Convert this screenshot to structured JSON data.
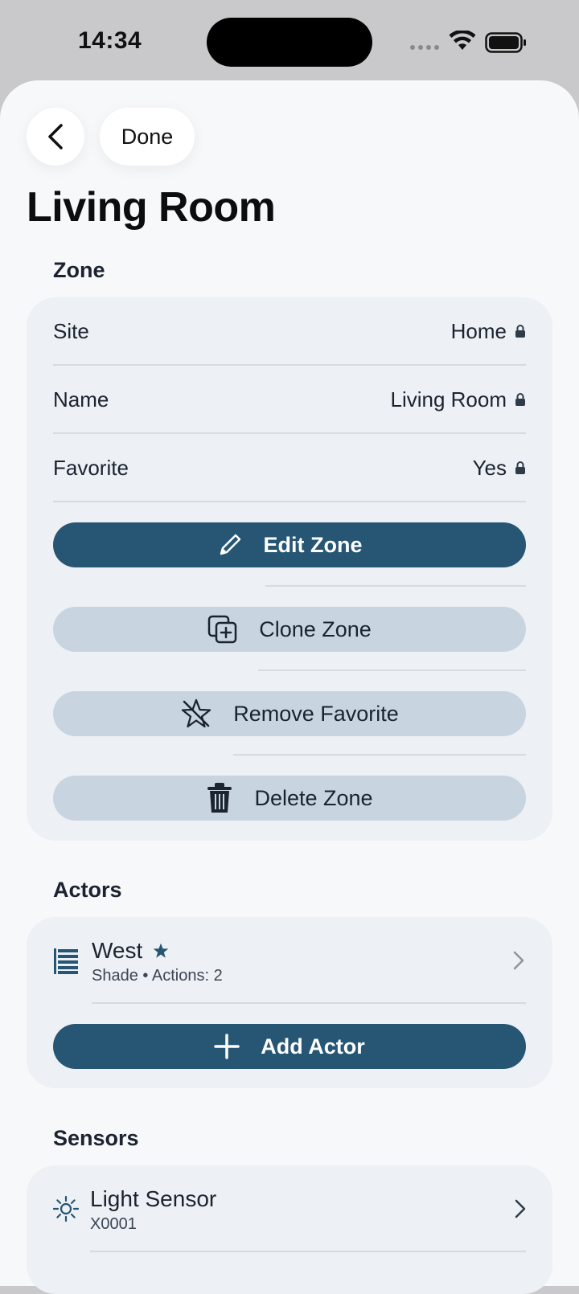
{
  "status_bar": {
    "time": "14:34"
  },
  "nav": {
    "done_label": "Done"
  },
  "page": {
    "title": "Living Room"
  },
  "zone": {
    "header": "Zone",
    "rows": [
      {
        "label": "Site",
        "value": "Home"
      },
      {
        "label": "Name",
        "value": "Living Room"
      },
      {
        "label": "Favorite",
        "value": "Yes"
      }
    ],
    "buttons": {
      "edit": "Edit Zone",
      "clone": "Clone Zone",
      "favorite": "Remove Favorite",
      "delete": "Delete Zone"
    }
  },
  "actors": {
    "header": "Actors",
    "items": [
      {
        "name": "West",
        "type": "Shade",
        "actions": "Actions: 2"
      }
    ],
    "separator": "•",
    "add_label": "Add Actor"
  },
  "sensors": {
    "header": "Sensors",
    "items": [
      {
        "name": "Light Sensor",
        "id": "X0001"
      }
    ]
  },
  "colors": {
    "accent": "#265673",
    "secondary_button": "#c8d5e0",
    "card": "#edf0f4",
    "background": "#f7f8fa"
  }
}
